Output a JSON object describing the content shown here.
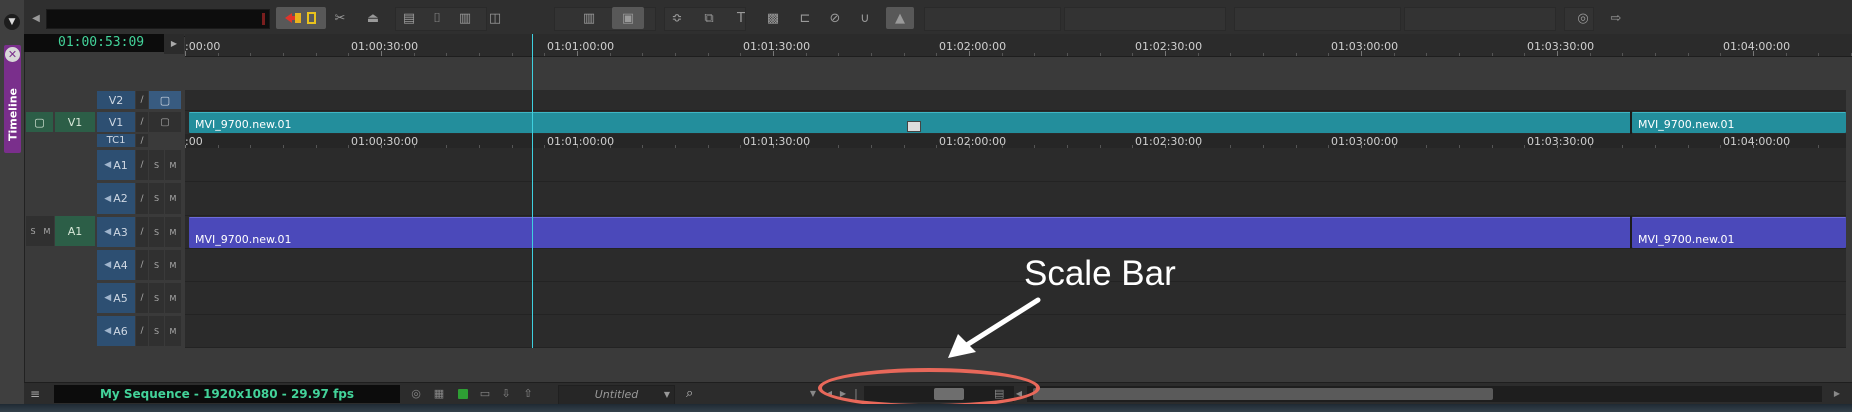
{
  "sidebar": {
    "title": "Timeline",
    "menu_glyph": "▼",
    "close_glyph": "✕"
  },
  "toolbar": {
    "icons": [
      "back-icon",
      "lift-icon",
      "extract-icon",
      "splice-icon",
      "segment-icon",
      "overwrite-icon",
      "trim-icon",
      "split-icon",
      "ripple-icon",
      "slip-icon",
      "insert-icon",
      "replace-icon",
      "effects-icon",
      "render-icon",
      "titler-icon",
      "mask-icon",
      "keyframe-icon",
      "cancel-icon",
      "bezier-icon",
      "smooth-icon",
      "grab-icon"
    ]
  },
  "master_timecode": "01:00:53:09",
  "ruler": {
    "labels": [
      ":00:00",
      "01:00:30:00",
      "01:01:00:00",
      "01:01:30:00",
      "01:02:00:00",
      "01:02:30:00",
      "01:03:00:00",
      "01:03:30:00",
      "01:04:00:00"
    ]
  },
  "tc_ruler": {
    "labels": ":00",
    "01:00:30:00": null
  }
}
